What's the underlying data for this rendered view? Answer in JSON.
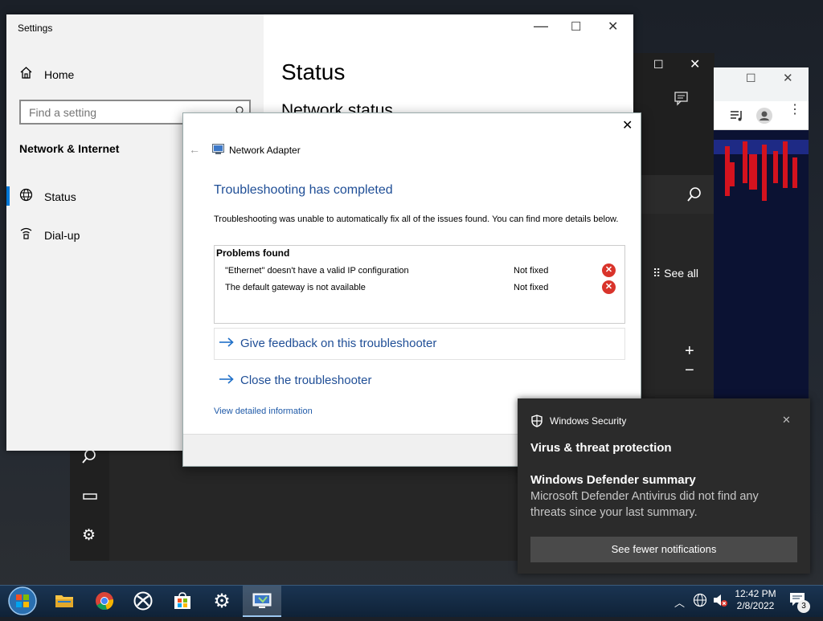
{
  "settings": {
    "window_title": "Settings",
    "home_label": "Home",
    "search_placeholder": "Find a setting",
    "section_label": "Network & Internet",
    "nav": [
      {
        "label": "Status"
      },
      {
        "label": "Dial-up"
      }
    ],
    "page_title": "Status",
    "subheading": "Network status"
  },
  "troubleshooter": {
    "window_title": "Network Adapter",
    "heading": "Troubleshooting has completed",
    "description": "Troubleshooting was unable to automatically fix all of the issues found. You can find more details below.",
    "problems_header": "Problems found",
    "problems": [
      {
        "name": "\"Ethernet\" doesn't have a valid IP configuration",
        "status": "Not fixed"
      },
      {
        "name": "The default gateway is not available",
        "status": "Not fixed"
      }
    ],
    "feedback_label": "Give feedback on this troubleshooter",
    "close_label": "Close the troubleshooter",
    "details_link": "View detailed information"
  },
  "background_app": {
    "see_all_label": "See all",
    "plus": "+",
    "minus": "−"
  },
  "notification": {
    "app_name": "Windows Security",
    "title": "Virus & threat protection",
    "summary_title": "Windows Defender summary",
    "summary_body": "Microsoft Defender Antivirus did not find any threats since your last summary.",
    "button_label": "See fewer notifications"
  },
  "taskbar": {
    "time": "12:42 PM",
    "date": "2/8/2022",
    "notification_count": "3"
  },
  "colors": {
    "accent_blue": "#1f4e96",
    "error_red": "#d9342b",
    "selected_bar": "#0078d7"
  }
}
